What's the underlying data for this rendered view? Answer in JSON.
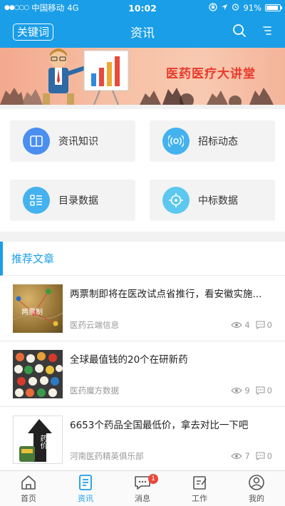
{
  "status_bar": {
    "signal": "●●○○○",
    "carrier": "中国移动",
    "network": "4G",
    "time": "10:02",
    "battery": "91%",
    "battery_level": 0.91
  },
  "nav": {
    "keyword_button": "关键词",
    "title": "资讯"
  },
  "banner": {
    "text": "医药医疗大讲堂"
  },
  "menu": [
    {
      "label": "资讯知识",
      "icon": "book-icon",
      "color": "#4a8ef0"
    },
    {
      "label": "招标动态",
      "icon": "broadcast-icon",
      "color": "#44b2ee"
    },
    {
      "label": "目录数据",
      "icon": "list-icon",
      "color": "#44b2ee"
    },
    {
      "label": "中标数据",
      "icon": "target-icon",
      "color": "#5cc8ef"
    }
  ],
  "section": {
    "title": "推荐文章"
  },
  "articles": [
    {
      "title": "两票制即将在医改试点省推行，看安徽实施...",
      "source": "医药云端信息",
      "views": "4",
      "comments": "0",
      "thumb_text": "两票制"
    },
    {
      "title": "全球最值钱的20个在研新药",
      "source": "医药魔方数据",
      "views": "9",
      "comments": "0",
      "thumb_text": ""
    },
    {
      "title": "6653个药品全国最低价，拿去对比一下吧",
      "source": "河南医药精英俱乐部",
      "views": "7",
      "comments": "0",
      "thumb_text": "药价"
    }
  ],
  "tabbar": [
    {
      "label": "首页",
      "icon": "home-icon"
    },
    {
      "label": "资讯",
      "icon": "news-icon",
      "active": true
    },
    {
      "label": "消息",
      "icon": "message-icon",
      "badge": "1"
    },
    {
      "label": "工作",
      "icon": "work-icon"
    },
    {
      "label": "我的",
      "icon": "profile-icon"
    }
  ],
  "colors": {
    "primary": "#1a9ee8",
    "badge": "#e84a3b",
    "banner_text": "#e83b2c"
  }
}
